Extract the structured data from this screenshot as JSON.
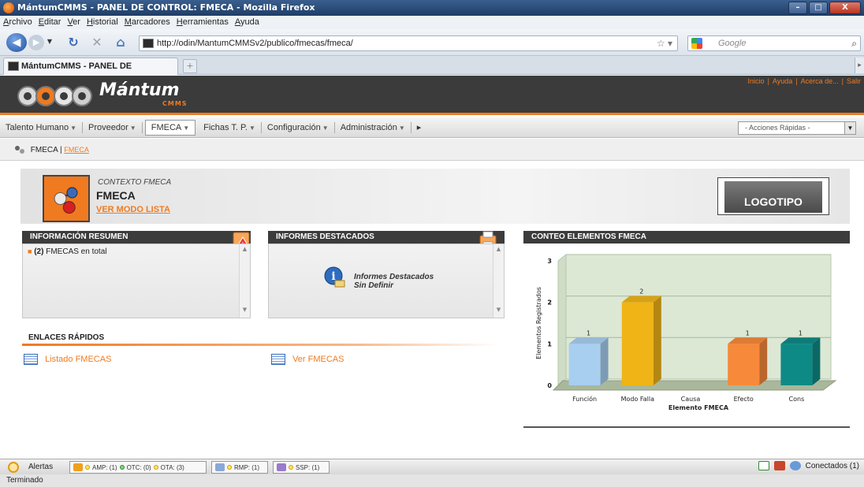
{
  "window": {
    "title": "MántumCMMS - PANEL DE CONTROL: FMECA - Mozilla Firefox",
    "buttons": [
      "–",
      "□",
      "X"
    ]
  },
  "menubar": [
    "Archivo",
    "Editar",
    "Ver",
    "Historial",
    "Marcadores",
    "Herramientas",
    "Ayuda"
  ],
  "toolbar": {
    "url": "http://odin/MantumCMMSv2/publico/fmecas/fmeca/",
    "search_placeholder": "Google"
  },
  "tabs": [
    {
      "label": "MántumCMMS - PANEL DE CONTROL..."
    }
  ],
  "header": {
    "brand": "Mántum",
    "brand_sub": "CMMS",
    "links": [
      "Inicio",
      "Ayuda",
      "Acerca de...",
      "Salir"
    ]
  },
  "modnav": {
    "items": [
      "Talento Humano",
      "Proveedor",
      "FMECA",
      "Fichas T. P.",
      "Configuración",
      "Administración"
    ],
    "active": "FMECA",
    "quick_actions": "- Acciones Rápidas -"
  },
  "breadcrumb": {
    "root": "FMECA",
    "current": "FMECA"
  },
  "context": {
    "label": "CONTEXTO FMECA",
    "title": "FMECA",
    "link": "VER MODO LISTA",
    "logo_text": "LOGOTIPO"
  },
  "panels": {
    "resumen": {
      "title": "INFORMACIÓN RESUMEN",
      "count": "(2)",
      "item": "FMECAS en total"
    },
    "informes": {
      "title": "INFORMES DESTACADOS",
      "line1": "Informes Destacados",
      "line2": "Sin Definir"
    },
    "conteo": {
      "title": "CONTEO ELEMENTOS FMECA"
    }
  },
  "quick_links": {
    "title": "ENLACES RÁPIDOS",
    "items": [
      "Listado FMECAS",
      "Ver FMECAS"
    ]
  },
  "chart_data": {
    "type": "bar",
    "categories": [
      "Función",
      "Modo Falla",
      "Causa",
      "Efecto",
      "Cons"
    ],
    "values": [
      1,
      2,
      0,
      1,
      1
    ],
    "value_labels": [
      "1",
      "2",
      "",
      "1",
      "1"
    ],
    "colors": [
      "#a8cff0",
      "#f0b416",
      "#999999",
      "#f7893a",
      "#0e8a86"
    ],
    "xlabel": "Elemento FMECA",
    "ylabel": "Elementos Registrados",
    "ylim": [
      0,
      3
    ],
    "y_ticks": [
      0,
      1,
      1,
      2,
      2,
      3
    ],
    "y_tick_labels": [
      "0",
      "1",
      "1",
      "2",
      "2",
      "3"
    ],
    "grid": true
  },
  "alerts": {
    "label": "Alertas",
    "amp": "AMP: (1)",
    "otc": "OTC: (0)",
    "ota": "OTA: (3)",
    "rmp": "RMP: (1)",
    "ssp": "SSP: (1)",
    "connected": "Conectados (1)"
  },
  "status": "Terminado"
}
